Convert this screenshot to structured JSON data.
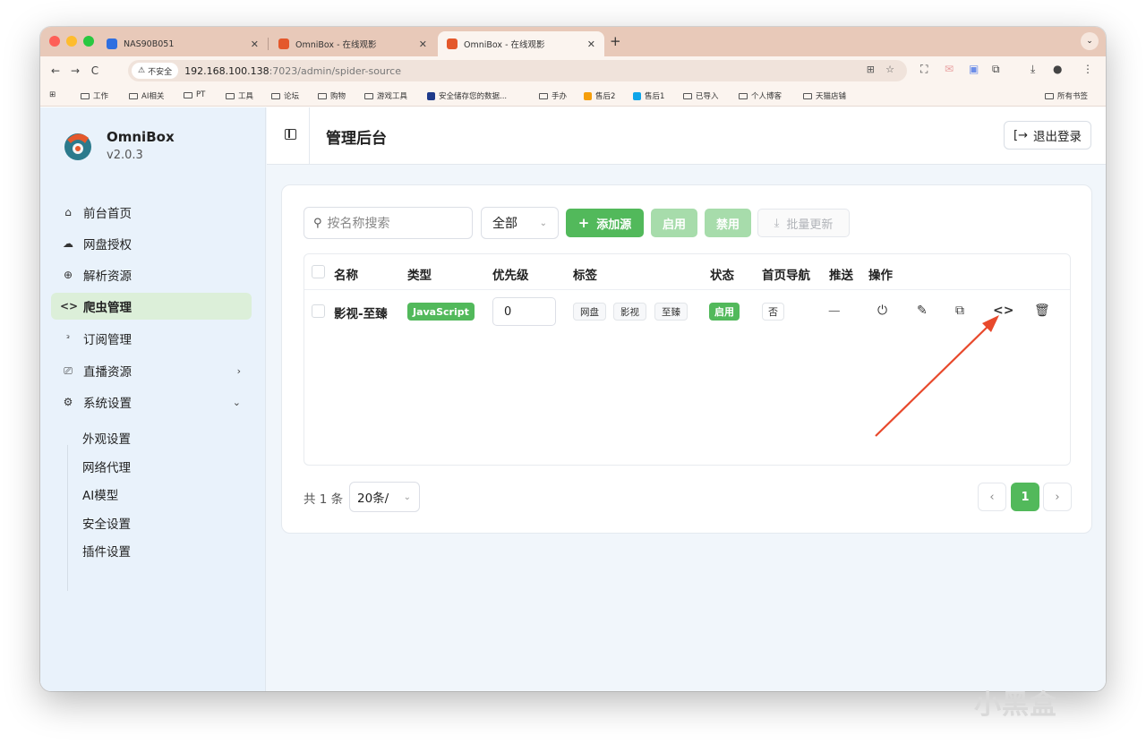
{
  "browser": {
    "tabs": [
      {
        "title": "NAS90B051",
        "favicon_color": "#2f6fe0"
      },
      {
        "title": "OmniBox - 在线观影",
        "favicon_color": "#e4582b"
      },
      {
        "title": "OmniBox - 在线观影",
        "favicon_color": "#e4582b"
      }
    ],
    "new_tab": "+",
    "nav": {
      "back": "←",
      "forward": "→",
      "reload": "C"
    },
    "security_label": "不安全",
    "url_host": "192.168.100.138",
    "url_path": ":7023/admin/spider-source",
    "bookmarks": [
      "工作",
      "AI相关",
      "PT",
      "工具",
      "论坛",
      "购物",
      "游戏工具",
      "安全储存您的数据...",
      "手办",
      "售后2",
      "售后1",
      "已导入",
      "个人博客",
      "天猫店铺"
    ],
    "all_bookmarks": "所有书签"
  },
  "sidebar": {
    "brand_name": "OmniBox",
    "version": "v2.0.3",
    "items": [
      {
        "label": "前台首页",
        "icon": "home-icon"
      },
      {
        "label": "网盘授权",
        "icon": "cloud-icon"
      },
      {
        "label": "解析资源",
        "icon": "globe-icon"
      },
      {
        "label": "爬虫管理",
        "icon": "code-icon"
      },
      {
        "label": "订阅管理",
        "icon": "rss-icon"
      },
      {
        "label": "直播资源",
        "icon": "tv-icon"
      },
      {
        "label": "系统设置",
        "icon": "gear-icon"
      }
    ],
    "sub_items": [
      "外观设置",
      "网络代理",
      "AI模型",
      "安全设置",
      "插件设置"
    ]
  },
  "header": {
    "title": "管理后台",
    "logout_label": "退出登录"
  },
  "toolbar": {
    "search_placeholder": "按名称搜索",
    "filter_value": "全部",
    "add_label": "添加源",
    "enable_label": "启用",
    "disable_label": "禁用",
    "batch_update_label": "批量更新"
  },
  "table": {
    "columns": [
      "名称",
      "类型",
      "优先级",
      "标签",
      "状态",
      "首页导航",
      "推送",
      "操作"
    ],
    "rows": [
      {
        "name": "影视-至臻",
        "type": "JavaScript",
        "priority": "0",
        "tags": [
          "网盘",
          "影视",
          "至臻"
        ],
        "status": "启用",
        "home_nav": "否",
        "push": "—"
      }
    ]
  },
  "pagination": {
    "total": "共 1 条",
    "page_size": "20条/",
    "current_page": "1"
  },
  "colors": {
    "accent": "#52b95b",
    "annotation_arrow": "#e8492c"
  },
  "watermark": "小黑盒"
}
